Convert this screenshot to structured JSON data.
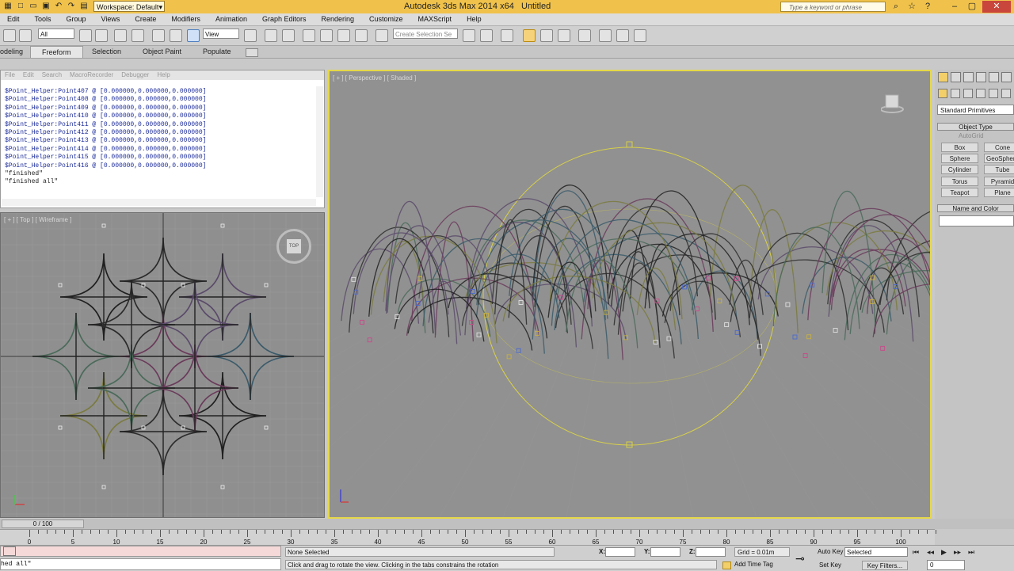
{
  "app": {
    "title": "Autodesk 3ds Max  2014 x64",
    "document": "Untitled",
    "workspace": "Workspace: Default",
    "search_placeholder": "Type a keyword or phrase"
  },
  "menu": [
    "Edit",
    "Tools",
    "Group",
    "Views",
    "Create",
    "Modifiers",
    "Animation",
    "Graph Editors",
    "Rendering",
    "Customize",
    "MAXScript",
    "Help"
  ],
  "toolbar": {
    "selection_filter": "All",
    "reference_coord": "View",
    "selection_set_placeholder": "Create Selection Se"
  },
  "ribbon": {
    "tabs": [
      "odeling",
      "Freeform",
      "Selection",
      "Object Paint",
      "Populate"
    ],
    "selected": "Freeform"
  },
  "listener": {
    "menu": [
      "File",
      "Edit",
      "Search",
      "MacroRecorder",
      "Debugger",
      "Help"
    ],
    "lines": [
      "$Point_Helper:Point407 @ [0.000000,0.000000,0.000000]",
      "$Point_Helper:Point408 @ [0.000000,0.000000,0.000000]",
      "$Point_Helper:Point409 @ [0.000000,0.000000,0.000000]",
      "$Point_Helper:Point410 @ [0.000000,0.000000,0.000000]",
      "$Point_Helper:Point411 @ [0.000000,0.000000,0.000000]",
      "$Point_Helper:Point412 @ [0.000000,0.000000,0.000000]",
      "$Point_Helper:Point413 @ [0.000000,0.000000,0.000000]",
      "$Point_Helper:Point414 @ [0.000000,0.000000,0.000000]",
      "$Point_Helper:Point415 @ [0.000000,0.000000,0.000000]",
      "$Point_Helper:Point416 @ [0.000000,0.000000,0.000000]"
    ],
    "finished_lines": [
      "\"finished\"",
      "\"finished all\""
    ]
  },
  "viewports": {
    "top_label": "[ + ] [ Top ] [ Wireframe ]",
    "persp_label": "[ + ] [ Perspective ] [ Shaded ]",
    "viewcube_top": "TOP"
  },
  "command_panel": {
    "category": "Standard Primitives",
    "object_type_title": "Object Type",
    "autogrid": "AutoGrid",
    "buttons": [
      "Box",
      "Cone",
      "Sphere",
      "GeoSphere",
      "Cylinder",
      "Tube",
      "Torus",
      "Pyramid",
      "Teapot",
      "Plane"
    ],
    "name_and_color_title": "Name and Color"
  },
  "timeline": {
    "frame_counter": "0 / 100",
    "ticks": [
      "0",
      "5",
      "10",
      "15",
      "20",
      "25",
      "30",
      "35",
      "40",
      "45",
      "50",
      "55",
      "60",
      "65",
      "70",
      "75",
      "80",
      "85",
      "90",
      "95",
      "100"
    ]
  },
  "status": {
    "maxscript_mini": "hed all\"",
    "selection_info": "None Selected",
    "prompt": "Click and drag to rotate the view.  Clicking in the tabs constrains the rotation",
    "x_label": "X:",
    "y_label": "Y:",
    "z_label": "Z:",
    "grid": "Grid = 0.01m",
    "add_time_tag": "Add Time Tag",
    "auto_key": "Auto Key",
    "set_key": "Set Key",
    "key_mode": "Selected",
    "key_filters": "Key Filters...",
    "current_frame": "0"
  }
}
